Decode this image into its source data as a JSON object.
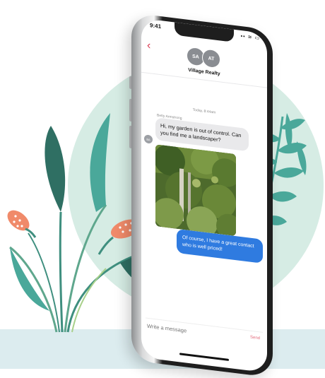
{
  "status_bar": {
    "time": "9:41",
    "icons": "▪▪ ≋ ▭"
  },
  "conversation": {
    "back_icon": "chevron-left-icon",
    "avatars": [
      {
        "initials": "SA"
      },
      {
        "initials": "AT"
      }
    ],
    "contact_name": "Village Realty",
    "timestamp": "Today, 8:44am",
    "incoming_sender": "Betty Armstrong",
    "incoming_sender_initials": "BA",
    "incoming_message": "Hi, my garden is out of control. Can you find me a landscaper?",
    "outgoing_message": "Of course, I have a great contact who is well priced!"
  },
  "composer": {
    "placeholder": "Write a message",
    "send_label": "Send"
  },
  "colors": {
    "outgoing_bubble": "#2f7be0",
    "incoming_bubble": "#e9e9eb",
    "accent": "#d8374e",
    "background_circle": "#d6ece4",
    "floor": "#dcecef"
  }
}
